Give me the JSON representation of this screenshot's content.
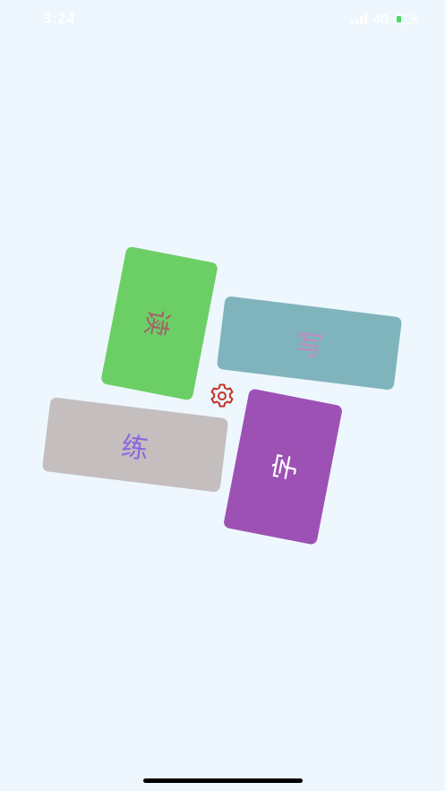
{
  "status_bar": {
    "time": "3:24",
    "network": "4G",
    "battery_fill": 0.3,
    "battery_color": "#4cd964"
  },
  "tiles": [
    {
      "id": "read",
      "label": "读",
      "background": "#6ccf66",
      "text_color": "#a0636a"
    },
    {
      "id": "write",
      "label": "写",
      "background": "#80b4bc",
      "text_color": "#c08bc0"
    },
    {
      "id": "practice",
      "label": "练",
      "background": "#c4bebe",
      "text_color": "#8b66e0"
    },
    {
      "id": "character",
      "label": "字",
      "background": "#9e51b4",
      "text_color": "#ffffff"
    }
  ],
  "settings": {
    "icon": "gear-icon",
    "color": "#c4342a"
  },
  "colors": {
    "background": "#eef7fe"
  }
}
